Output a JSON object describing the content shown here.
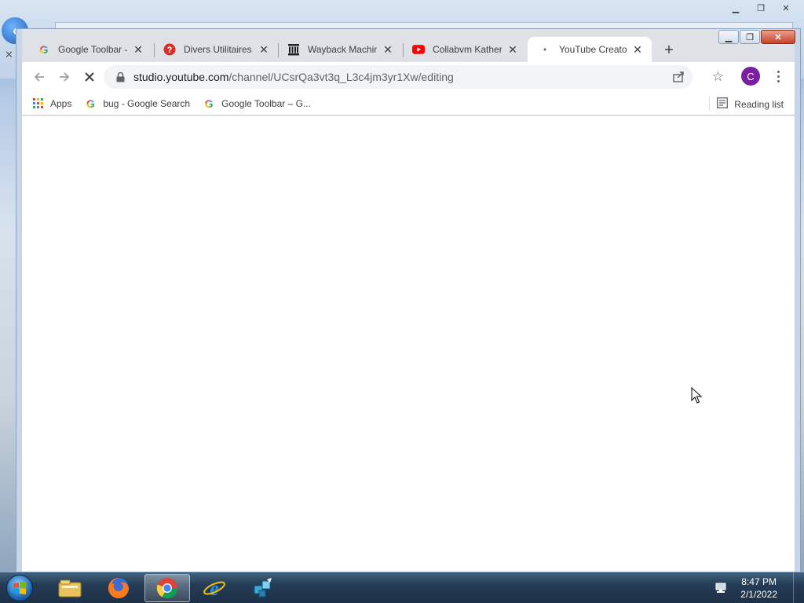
{
  "browser": {
    "tabs": [
      {
        "title": "Google Toolbar –",
        "icon": "google-icon"
      },
      {
        "title": "Divers Utilitaires",
        "icon": "help-icon"
      },
      {
        "title": "Wayback Machine",
        "icon": "wayback-icon"
      },
      {
        "title": "Collabvm Katheri",
        "icon": "youtube-icon"
      },
      {
        "title": "YouTube Creator",
        "icon": "loading-dot-icon"
      }
    ],
    "url": {
      "host": "studio.youtube.com",
      "path": "/channel/UCsrQa3vt3q_L3c4jm3yr1Xw/editing"
    },
    "profile_initial": "C",
    "bookmarks": [
      {
        "label": "Apps",
        "icon": "apps-grid-icon"
      },
      {
        "label": "bug - Google Search",
        "icon": "google-icon"
      },
      {
        "label": "Google Toolbar – G...",
        "icon": "google-icon"
      }
    ],
    "reading_list": "Reading list"
  },
  "taskbar": {
    "time": "8:47 PM",
    "date": "2/1/2022",
    "items": [
      "windows-explorer-icon",
      "firefox-icon",
      "chrome-icon",
      "internet-explorer-icon",
      "network-app-icon"
    ]
  },
  "colors": {
    "avatar": "#7b1fa2",
    "youtube_red": "#ff0000",
    "help_red": "#d93025"
  }
}
